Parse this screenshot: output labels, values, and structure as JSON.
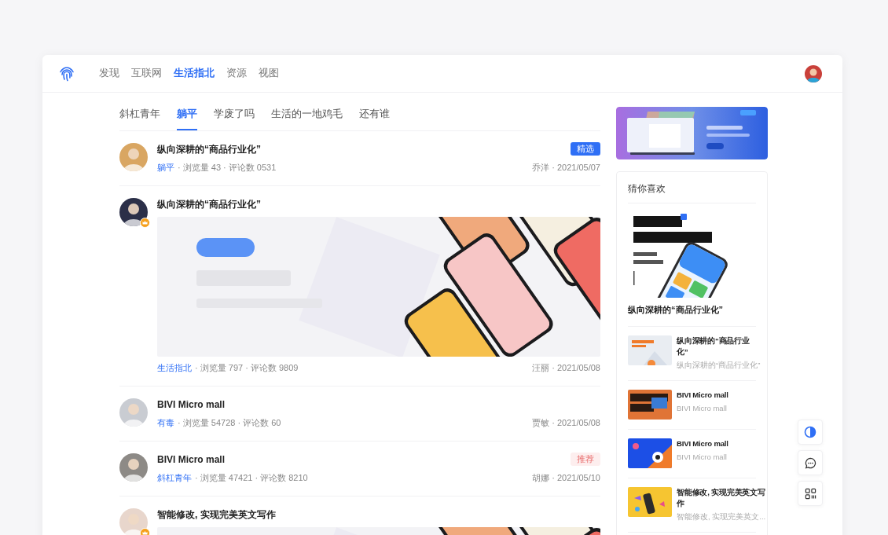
{
  "nav": {
    "items": [
      {
        "label": "发现",
        "selected": false
      },
      {
        "label": "互联网",
        "selected": false
      },
      {
        "label": "生活指北",
        "selected": true
      },
      {
        "label": "资源",
        "selected": false
      },
      {
        "label": "视图",
        "selected": false
      }
    ]
  },
  "subtabs": [
    {
      "label": "斜杠青年",
      "selected": false
    },
    {
      "label": "躺平",
      "selected": true
    },
    {
      "label": "学废了吗",
      "selected": false
    },
    {
      "label": "生活的一地鸡毛",
      "selected": false
    },
    {
      "label": "还有谁",
      "selected": false
    }
  ],
  "posts": [
    {
      "title": "纵向深耕的“商品行业化”",
      "verified": false,
      "tag": {
        "kind": "featured",
        "label": "精选"
      },
      "has_picture": false,
      "category": "躺平",
      "stats": "· 浏览量 43 · 评论数 0531",
      "byline": "乔洋 · 2021/05/07"
    },
    {
      "title": "纵向深耕的“商品行业化”",
      "verified": true,
      "has_picture": true,
      "category": "生活指北",
      "stats": "· 浏览量 797 · 评论数 9809",
      "byline": "汪丽 · 2021/05/08"
    },
    {
      "title": "BIVI Micro mall",
      "verified": false,
      "has_picture": false,
      "category": "有毒",
      "stats": "· 浏览量 54728 · 评论数 60",
      "byline": "贾敏 · 2021/05/08"
    },
    {
      "title": "BIVI Micro mall",
      "verified": false,
      "tag": {
        "kind": "recommended",
        "label": "推荐"
      },
      "has_picture": false,
      "category": "斜杠青年",
      "stats": "· 浏览量 47421 · 评论数 8210",
      "byline": "胡娜 · 2021/05/10"
    },
    {
      "title": "智能修改, 实现完美英文写作",
      "verified": true,
      "has_picture": true
    }
  ],
  "sidebar": {
    "title": "猜你喜欢",
    "featured": {
      "title": "纵向深耕的“商品行业化”"
    },
    "items": [
      {
        "title": "纵向深耕的“商品行业化”",
        "subtitle": "纵向深耕的“商品行业化”"
      },
      {
        "title": "BIVI Micro mall",
        "subtitle": "BIVI Micro mall"
      },
      {
        "title": "BIVI Micro mall",
        "subtitle": "BIVI Micro mall"
      },
      {
        "title": "智能修改, 实现完美英文写作",
        "subtitle": "智能修改, 实现完美英文..."
      }
    ]
  }
}
